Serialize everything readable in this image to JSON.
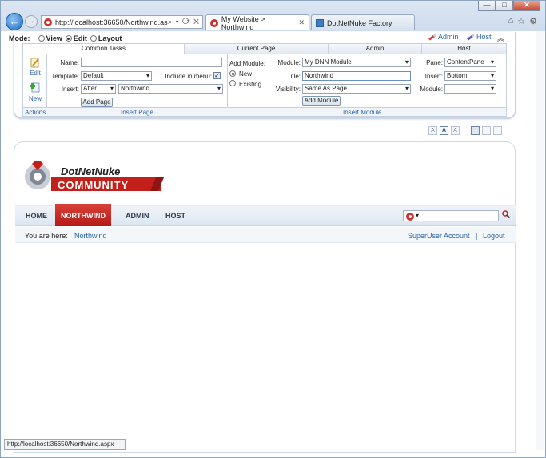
{
  "browser": {
    "window_controls": {
      "minimize": "—",
      "maximize": "□",
      "close": "✕"
    },
    "back_glyph": "←",
    "forward_glyph": "→",
    "address": "http://localhost:36650/Northwind.as",
    "address_glyphs": "⌕ ▾ ⟳ ✕",
    "tabs": [
      {
        "label": "My Website > Northwind",
        "close": "✕"
      },
      {
        "label": "DotNetNuke Factory"
      }
    ],
    "toolbar_icons": [
      "home-icon",
      "star-icon",
      "gear-icon"
    ],
    "toolbar_glyphs": {
      "home": "⌂",
      "star": "☆",
      "gear": "⚙"
    },
    "status_url": "http://localhost:36650/Northwind.aspx"
  },
  "controlbar": {
    "mode_label": "Mode:",
    "modes": [
      {
        "label": "View",
        "selected": false
      },
      {
        "label": "Edit",
        "selected": true
      },
      {
        "label": "Layout",
        "selected": false
      }
    ],
    "admin_link": "Admin",
    "host_link": "Host",
    "collapse_glyph": "︽",
    "tabs": [
      "Common Tasks",
      "Current Page",
      "Admin",
      "Host"
    ],
    "actions": {
      "edit": "Edit",
      "new": "New",
      "footer": "Actions"
    },
    "insert_page": {
      "name_label": "Name:",
      "name_value": "",
      "template_label": "Template:",
      "template_value": "Default",
      "include_label": "Include in menu:",
      "include_checked": true,
      "check_glyph": "✓",
      "insert_label": "Insert:",
      "insert_value": "After",
      "page_value": "Northwind",
      "add_button": "Add Page",
      "footer": "Insert Page"
    },
    "insert_module": {
      "add_label": "Add Module:",
      "new_label": "New",
      "existing_label": "Existing",
      "module_label": "Module:",
      "module_value": "My DNN Module",
      "title_label": "Title:",
      "title_value": "Northwind",
      "visibility_label": "Visibility:",
      "visibility_value": "Same As Page",
      "pane_label": "Pane:",
      "pane_value": "ContentPane",
      "insert_label": "Insert:",
      "insert_value": "Bottom",
      "module2_label": "Module:",
      "module2_value": "",
      "add_button": "Add Module",
      "footer": "Insert Module"
    }
  },
  "skin_buttons": [
    "A",
    "A",
    "A"
  ],
  "site": {
    "logo_top": "DotNetNuke",
    "logo_bottom": "COMMUNITY",
    "menu": [
      "HOME",
      "NORTHWIND",
      "ADMIN",
      "HOST"
    ],
    "active_menu": "NORTHWIND",
    "search_value": "▾",
    "you_are_here": "You are here:",
    "breadcrumb": "Northwind",
    "account": "SuperUser Account",
    "separator": "|",
    "logout": "Logout"
  },
  "colors": {
    "accent_red": "#c4201b",
    "link_blue": "#2a62a6"
  }
}
